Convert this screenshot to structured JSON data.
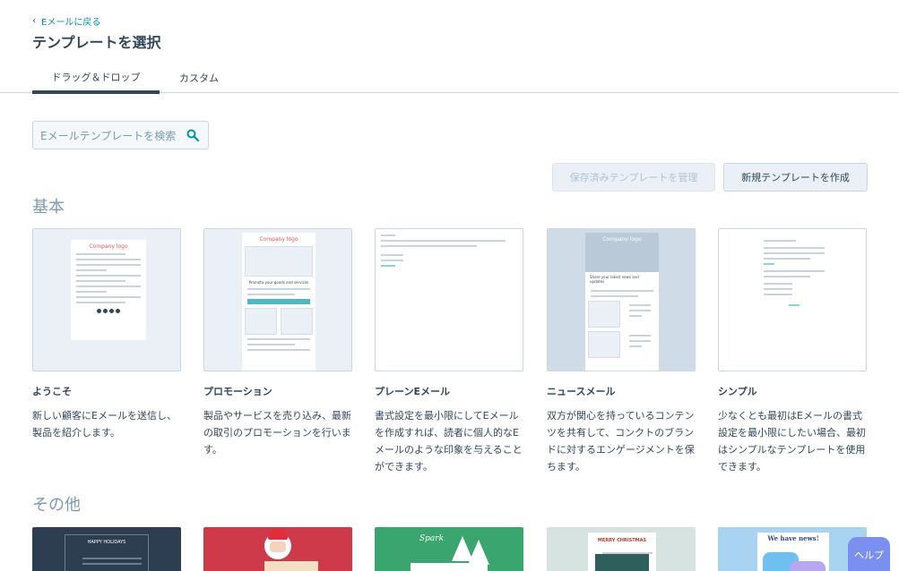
{
  "nav": {
    "back_label": "Eメールに戻る"
  },
  "page": {
    "title": "テンプレートを選択"
  },
  "tabs": [
    {
      "label": "ドラッグ＆ドロップ",
      "active": true
    },
    {
      "label": "カスタム",
      "active": false
    }
  ],
  "search": {
    "placeholder": "Eメールテンプレートを検索",
    "icon": "search-icon"
  },
  "actions": {
    "manage_label": "保存済みテンプレートを管理",
    "create_label": "新規テンプレートを作成"
  },
  "sections": {
    "basic": "基本",
    "other": "その他"
  },
  "templates": [
    {
      "name": "ようこそ",
      "description": "新しい顧客にEメールを送信し、製品を紹介します。",
      "preview_logo": "Company logo"
    },
    {
      "name": "プロモーション",
      "description": "製品やサービスを売り込み、最新の取引のプロモーションを行います。",
      "preview_logo": "Company logo",
      "preview_heading": "Promote your goods and services"
    },
    {
      "name": "プレーンEメール",
      "description": "書式設定を最小限にしてEメールを作成すれば、読者に個人的なEメールのような印象を与えることができます。"
    },
    {
      "name": "ニュースメール",
      "description": "双方が関心を持っているコンテンツを共有して、コンクトのブランドに対するエンゲージメントを保ちます。",
      "preview_logo": "Company logo",
      "preview_heading": "Share your latest news and updates"
    },
    {
      "name": "シンプル",
      "description": "少なくとも最初はEメールの書式設定を最小限にしたい場合、最初はシンプルなテンプレートを使用できます。"
    }
  ],
  "other_previews": [
    {
      "caption": "HAPPY HOLIDAYS"
    },
    {
      "caption": ""
    },
    {
      "caption": "Spark"
    },
    {
      "caption": "MERRY CHRISTMAS"
    },
    {
      "caption": "We have news!"
    }
  ],
  "help": {
    "label": "ヘルプ"
  },
  "colors": {
    "text": "#33475b",
    "link": "#0091ae",
    "border": "#cbd6e2",
    "accent_red": "#f2545b",
    "accent_teal": "#51b8bf",
    "help_bg": "#7b8ff0"
  }
}
